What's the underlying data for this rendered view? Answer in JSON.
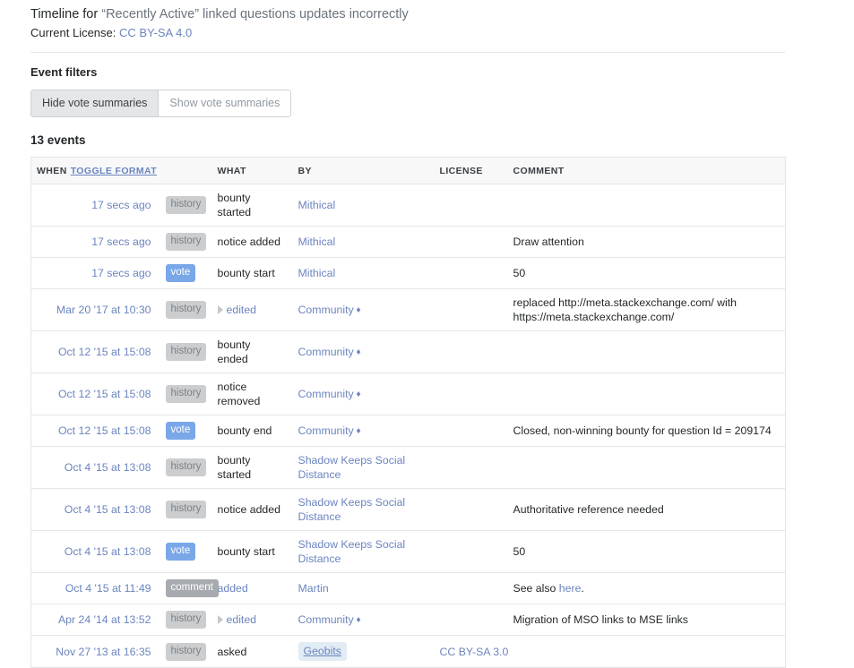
{
  "header": {
    "timeline_prefix": "Timeline for ",
    "question_title": "“Recently Active” linked questions updates incorrectly",
    "license_label": "Current License: ",
    "license_link": "CC BY-SA 4.0"
  },
  "filters": {
    "heading": "Event filters",
    "hide_vote_summaries": "Hide vote summaries",
    "show_vote_summaries": "Show vote summaries",
    "selected": "Hide vote summaries"
  },
  "events_count": "13 events",
  "table": {
    "columns": {
      "when": "when",
      "toggle_format": "toggle format",
      "what": "what",
      "by": "by",
      "license": "license",
      "comment": "comment"
    },
    "rows": [
      {
        "when": "17 secs ago",
        "type": "history",
        "type_style": "history",
        "what": "bounty started",
        "what_is_link": false,
        "expandable": false,
        "by": "Mithical",
        "by_style": "link",
        "by_diamond": false,
        "license": "",
        "comment": "",
        "comment_link": "",
        "comment_suffix": ""
      },
      {
        "when": "17 secs ago",
        "type": "history",
        "type_style": "history",
        "what": "notice added",
        "what_is_link": false,
        "expandable": false,
        "by": "Mithical",
        "by_style": "link",
        "by_diamond": false,
        "license": "",
        "comment": "Draw attention",
        "comment_link": "",
        "comment_suffix": ""
      },
      {
        "when": "17 secs ago",
        "type": "vote",
        "type_style": "vote",
        "what": "bounty start",
        "what_is_link": false,
        "expandable": false,
        "by": "Mithical",
        "by_style": "link",
        "by_diamond": false,
        "license": "",
        "comment": "50",
        "comment_link": "",
        "comment_suffix": ""
      },
      {
        "when": "Mar 20 '17 at 10:30",
        "type": "history",
        "type_style": "history",
        "what": "edited",
        "what_is_link": true,
        "expandable": true,
        "by": "Community",
        "by_style": "link",
        "by_diamond": true,
        "license": "",
        "comment": "replaced http://meta.stackexchange.com/ with https://meta.stackexchange.com/",
        "comment_link": "",
        "comment_suffix": ""
      },
      {
        "when": "Oct 12 '15 at 15:08",
        "type": "history",
        "type_style": "history",
        "what": "bounty ended",
        "what_is_link": false,
        "expandable": false,
        "by": "Community",
        "by_style": "link",
        "by_diamond": true,
        "license": "",
        "comment": "",
        "comment_link": "",
        "comment_suffix": ""
      },
      {
        "when": "Oct 12 '15 at 15:08",
        "type": "history",
        "type_style": "history",
        "what": "notice removed",
        "what_is_link": false,
        "expandable": false,
        "by": "Community",
        "by_style": "link",
        "by_diamond": true,
        "license": "",
        "comment": "",
        "comment_link": "",
        "comment_suffix": ""
      },
      {
        "when": "Oct 12 '15 at 15:08",
        "type": "vote",
        "type_style": "vote",
        "what": "bounty end",
        "what_is_link": false,
        "expandable": false,
        "by": "Community",
        "by_style": "link",
        "by_diamond": true,
        "license": "",
        "comment": "Closed, non-winning bounty for question Id = 209174",
        "comment_link": "",
        "comment_suffix": ""
      },
      {
        "when": "Oct 4 '15 at 13:08",
        "type": "history",
        "type_style": "history",
        "what": "bounty started",
        "what_is_link": false,
        "expandable": false,
        "by": "Shadow Keeps Social Distance",
        "by_style": "link",
        "by_diamond": false,
        "license": "",
        "comment": "",
        "comment_link": "",
        "comment_suffix": ""
      },
      {
        "when": "Oct 4 '15 at 13:08",
        "type": "history",
        "type_style": "history",
        "what": "notice added",
        "what_is_link": false,
        "expandable": false,
        "by": "Shadow Keeps Social Distance",
        "by_style": "link",
        "by_diamond": false,
        "license": "",
        "comment": "Authoritative reference needed",
        "comment_link": "",
        "comment_suffix": ""
      },
      {
        "when": "Oct 4 '15 at 13:08",
        "type": "vote",
        "type_style": "vote",
        "what": "bounty start",
        "what_is_link": false,
        "expandable": false,
        "by": "Shadow Keeps Social Distance",
        "by_style": "link",
        "by_diamond": false,
        "license": "",
        "comment": "50",
        "comment_link": "",
        "comment_suffix": ""
      },
      {
        "when": "Oct 4 '15 at 11:49",
        "type": "comment",
        "type_style": "comment",
        "what": "added",
        "what_is_link": true,
        "expandable": false,
        "by": "Martin",
        "by_style": "link",
        "by_diamond": false,
        "license": "",
        "comment": "See also ",
        "comment_link": "here",
        "comment_suffix": "."
      },
      {
        "when": "Apr 24 '14 at 13:52",
        "type": "history",
        "type_style": "history",
        "what": "edited",
        "what_is_link": true,
        "expandable": true,
        "by": "Community",
        "by_style": "link",
        "by_diamond": true,
        "license": "",
        "comment": "Migration of MSO links to MSE links",
        "comment_link": "",
        "comment_suffix": ""
      },
      {
        "when": "Nov 27 '13 at 16:35",
        "type": "history",
        "type_style": "history",
        "what": "asked",
        "what_is_link": false,
        "expandable": false,
        "by": "Geobits",
        "by_style": "user-badge",
        "by_diamond": false,
        "license": "CC BY-SA 3.0",
        "comment": "",
        "comment_link": "",
        "comment_suffix": ""
      }
    ]
  },
  "colors": {
    "link": "#6b84bf",
    "vote_badge": "#7aa7e8",
    "history_badge": "#cbcdcf",
    "comment_badge": "#a7abaf",
    "user_badge_bg": "#e1ecf4",
    "border": "#e3e6e8"
  }
}
